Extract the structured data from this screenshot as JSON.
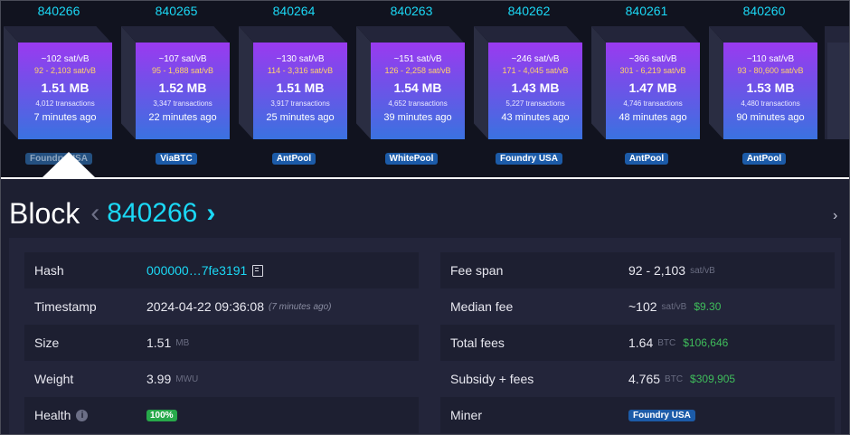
{
  "blocks": [
    {
      "height": "840266",
      "median_fee": "~102 sat/vB",
      "fee_range": "92 - 2,103 sat/vB",
      "size": "1.51 MB",
      "tx_count": "4,012 transactions",
      "ago": "7 minutes ago",
      "pool": "Foundry USA"
    },
    {
      "height": "840265",
      "median_fee": "~107 sat/vB",
      "fee_range": "95 - 1,688 sat/vB",
      "size": "1.52 MB",
      "tx_count": "3,347 transactions",
      "ago": "22 minutes ago",
      "pool": "ViaBTC"
    },
    {
      "height": "840264",
      "median_fee": "~130 sat/vB",
      "fee_range": "114 - 3,316 sat/vB",
      "size": "1.51 MB",
      "tx_count": "3,917 transactions",
      "ago": "25 minutes ago",
      "pool": "AntPool"
    },
    {
      "height": "840263",
      "median_fee": "~151 sat/vB",
      "fee_range": "126 - 2,258 sat/vB",
      "size": "1.54 MB",
      "tx_count": "4,652 transactions",
      "ago": "39 minutes ago",
      "pool": "WhitePool"
    },
    {
      "height": "840262",
      "median_fee": "~246 sat/vB",
      "fee_range": "171 - 4,045 sat/vB",
      "size": "1.43 MB",
      "tx_count": "5,227 transactions",
      "ago": "43 minutes ago",
      "pool": "Foundry USA"
    },
    {
      "height": "840261",
      "median_fee": "~366 sat/vB",
      "fee_range": "301 - 6,219 sat/vB",
      "size": "1.47 MB",
      "tx_count": "4,746 transactions",
      "ago": "48 minutes ago",
      "pool": "AntPool"
    },
    {
      "height": "840260",
      "median_fee": "~110 sat/vB",
      "fee_range": "93 - 80,600 sat/vB",
      "size": "1.53 MB",
      "tx_count": "4,480 transactions",
      "ago": "90 minutes ago",
      "pool": "AntPool"
    }
  ],
  "header": {
    "title": "Block",
    "height": "840266",
    "prev_icon": "chevron-left-icon",
    "next_icon": "chevron-right-icon"
  },
  "details_left": {
    "hash_label": "Hash",
    "hash_value": "000000…7fe3191",
    "timestamp_label": "Timestamp",
    "timestamp_value": "2024-04-22 09:36:08",
    "timestamp_relative": "(7 minutes ago)",
    "size_label": "Size",
    "size_value": "1.51",
    "size_unit": "MB",
    "weight_label": "Weight",
    "weight_value": "3.99",
    "weight_unit": "MWU",
    "health_label": "Health",
    "health_value": "100%"
  },
  "details_right": {
    "fee_span_label": "Fee span",
    "fee_span_value": "92 - 2,103",
    "fee_span_unit": "sat/vB",
    "median_fee_label": "Median fee",
    "median_fee_value": "~102",
    "median_fee_unit": "sat/vB",
    "median_fee_usd": "$9.30",
    "total_fees_label": "Total fees",
    "total_fees_value": "1.64",
    "total_fees_unit": "BTC",
    "total_fees_usd": "$106,646",
    "subsidy_label": "Subsidy + fees",
    "subsidy_value": "4.765",
    "subsidy_unit": "BTC",
    "subsidy_usd": "$309,905",
    "miner_label": "Miner",
    "miner_value": "Foundry USA"
  },
  "colors": {
    "accent": "#1bd8f5",
    "usd": "#3fbd5b",
    "pool_badge": "#1c5ba8",
    "health_badge": "#27a94a"
  }
}
